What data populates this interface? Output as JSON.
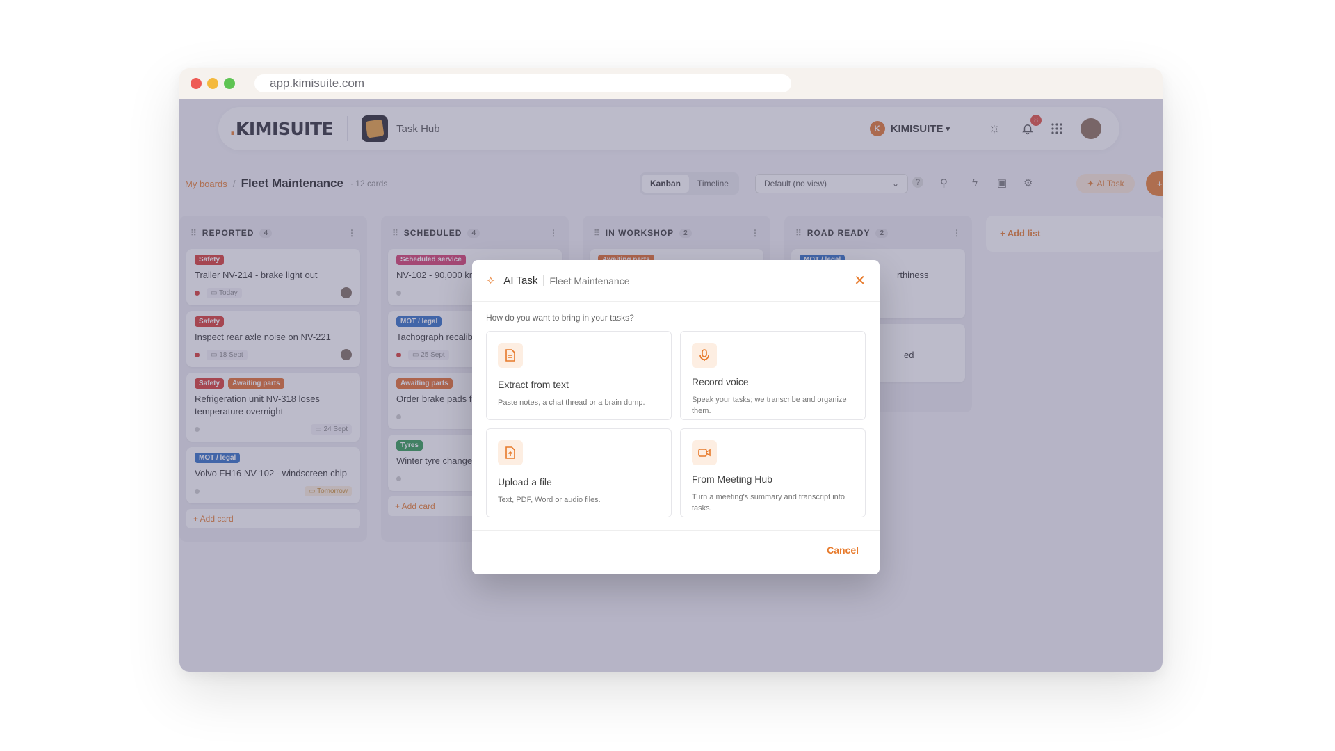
{
  "browser": {
    "url": "app.kimisuite.com"
  },
  "header": {
    "logo_text": "KIMISUITE",
    "app_name": "Task Hub",
    "org_name": "KIMISUITE",
    "org_initial": "K",
    "notification_count": "8"
  },
  "board": {
    "breadcrumb_root": "My boards",
    "breadcrumb_sep": "/",
    "title": "Fleet Maintenance",
    "card_count": "· 12 cards",
    "views": [
      "Kanban",
      "Timeline"
    ],
    "active_view": "Kanban",
    "view_select": "Default (no view)",
    "ai_task_label": "AI Task",
    "create_label": "+ Ca"
  },
  "columns": [
    {
      "name": "REPORTED",
      "count": "4",
      "cards": [
        {
          "tags": [
            {
              "label": "Safety",
              "color": "red"
            }
          ],
          "title": "Trailer NV-214 - brake light out",
          "priority": "hot",
          "date": "Today",
          "date_style": "normal",
          "avatar": true
        },
        {
          "tags": [
            {
              "label": "Safety",
              "color": "red"
            }
          ],
          "title": "Inspect rear axle noise on NV-221",
          "priority": "hot",
          "date": "18 Sept",
          "date_style": "normal",
          "avatar": true
        },
        {
          "tags": [
            {
              "label": "Safety",
              "color": "red"
            },
            {
              "label": "Awaiting parts",
              "color": "orange"
            }
          ],
          "title": "Refrigeration unit NV-318 loses temperature overnight",
          "priority": "normal",
          "date": "24 Sept",
          "date_style": "right",
          "avatar": false
        },
        {
          "tags": [
            {
              "label": "MOT / legal",
              "color": "blue"
            }
          ],
          "title": "Volvo FH16 NV-102 - windscreen chip",
          "priority": "normal",
          "date": "Tomorrow",
          "date_style": "warn",
          "avatar": false
        }
      ],
      "add_card": "+ Add card"
    },
    {
      "name": "SCHEDULED",
      "count": "4",
      "cards": [
        {
          "tags": [
            {
              "label": "Scheduled service",
              "color": "pink"
            }
          ],
          "title": "NV-102 - 90,000 km",
          "priority": "normal",
          "date": "",
          "date_style": "none",
          "avatar": false
        },
        {
          "tags": [
            {
              "label": "MOT / legal",
              "color": "blue"
            }
          ],
          "title": "Tachograph recalib NV-140",
          "priority": "hot",
          "date": "25 Sept",
          "date_style": "normal",
          "avatar": false
        },
        {
          "tags": [
            {
              "label": "Awaiting parts",
              "color": "orange"
            }
          ],
          "title": "Order brake pads f",
          "priority": "normal",
          "date": "",
          "date_style": "none",
          "avatar": false
        },
        {
          "tags": [
            {
              "label": "Tyres",
              "color": "green"
            }
          ],
          "title": "Winter tyre change",
          "priority": "normal",
          "date": "",
          "date_style": "none",
          "avatar": false
        }
      ],
      "add_card": "+ Add card"
    },
    {
      "name": "IN WORKSHOP",
      "count": "2",
      "cards": [
        {
          "tags": [
            {
              "label": "Awaiting parts",
              "color": "orange"
            }
          ],
          "title": "",
          "priority": "normal",
          "date": "",
          "date_style": "none",
          "avatar": false
        }
      ],
      "add_card": ""
    },
    {
      "name": "ROAD READY",
      "count": "2",
      "cards": [
        {
          "tags": [
            {
              "label": "MOT / legal",
              "color": "blue"
            }
          ],
          "title": "rthiness",
          "priority": "normal",
          "date": "",
          "date_style": "none",
          "avatar": false
        },
        {
          "tags": [],
          "title": "ed",
          "priority": "normal",
          "date": "",
          "date_style": "none",
          "avatar": false
        }
      ],
      "add_card": ""
    }
  ],
  "add_list": "+ Add list",
  "modal": {
    "title": "AI Task",
    "subtitle": "Fleet Maintenance",
    "prompt": "How do you want to bring in your tasks?",
    "options": [
      {
        "icon": "document-icon",
        "title": "Extract from text",
        "desc": "Paste notes, a chat thread or a brain dump."
      },
      {
        "icon": "microphone-icon",
        "title": "Record voice",
        "desc": "Speak your tasks; we transcribe and organize them."
      },
      {
        "icon": "upload-file-icon",
        "title": "Upload a file",
        "desc": "Text, PDF, Word or audio files."
      },
      {
        "icon": "video-camera-icon",
        "title": "From Meeting Hub",
        "desc": "Turn a meeting's summary and transcript into tasks."
      }
    ],
    "cancel": "Cancel"
  },
  "colors": {
    "accent": "#e77a2b",
    "overlay": "#605c80"
  }
}
